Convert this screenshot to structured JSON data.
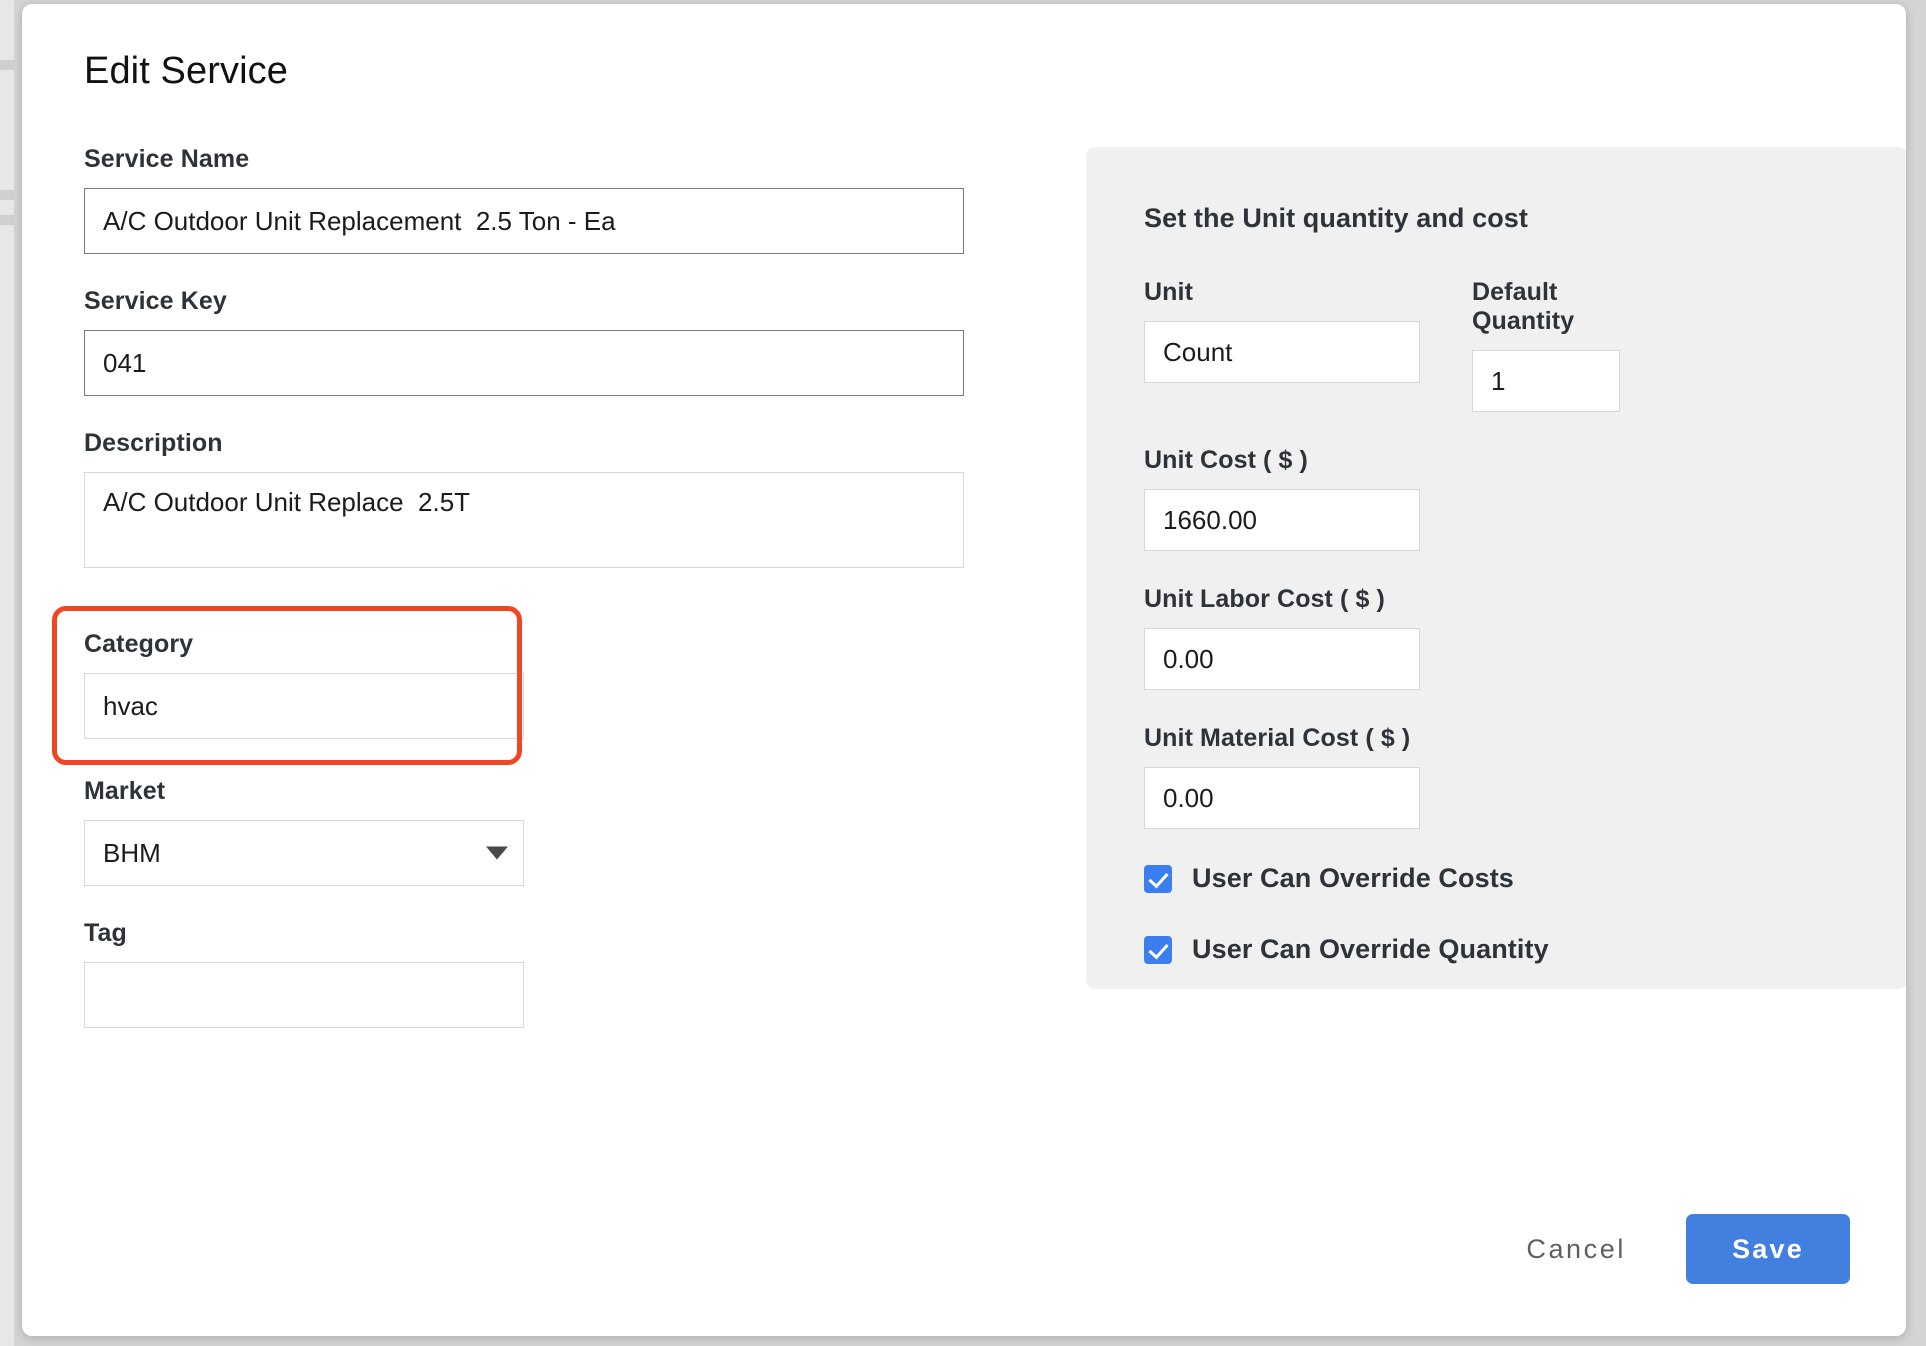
{
  "modal": {
    "title": "Edit Service"
  },
  "left_form": {
    "service_name": {
      "label": "Service Name",
      "value": "A/C Outdoor Unit Replacement  2.5 Ton - Ea",
      "placeholder": ""
    },
    "service_key": {
      "label": "Service Key",
      "value": "041",
      "placeholder": ""
    },
    "description": {
      "label": "Description",
      "value": "A/C Outdoor Unit Replace  2.5T",
      "placeholder": ""
    },
    "category": {
      "label": "Category",
      "value": "hvac",
      "placeholder": "",
      "highlight_color": "#ef4723"
    },
    "market": {
      "label": "Market",
      "value": "BHM",
      "options": [
        "BHM"
      ],
      "caret_icon": "chevron-down-icon"
    },
    "tag": {
      "label": "Tag",
      "value": "",
      "placeholder": ""
    }
  },
  "panel": {
    "title": "Set the Unit quantity and cost",
    "unit": {
      "label": "Unit",
      "value": "Count",
      "placeholder": ""
    },
    "default_quantity": {
      "label": "Default Quantity",
      "value": "1",
      "placeholder": ""
    },
    "unit_cost": {
      "label": "Unit Cost ( $ )",
      "value": "1660.00",
      "placeholder": ""
    },
    "unit_labor_cost": {
      "label": "Unit Labor Cost ( $ )",
      "value": "0.00",
      "placeholder": ""
    },
    "unit_material_cost": {
      "label": "Unit Material Cost ( $ )",
      "value": "0.00",
      "placeholder": ""
    },
    "override_costs": {
      "label": "User Can Override Costs",
      "checked": true
    },
    "override_quantity": {
      "label": "User Can Override Quantity",
      "checked": true
    },
    "checkbox_color": "#3b7ef0"
  },
  "footer": {
    "cancel_label": "Cancel",
    "save_label": "Save",
    "save_color": "#4280e0"
  }
}
